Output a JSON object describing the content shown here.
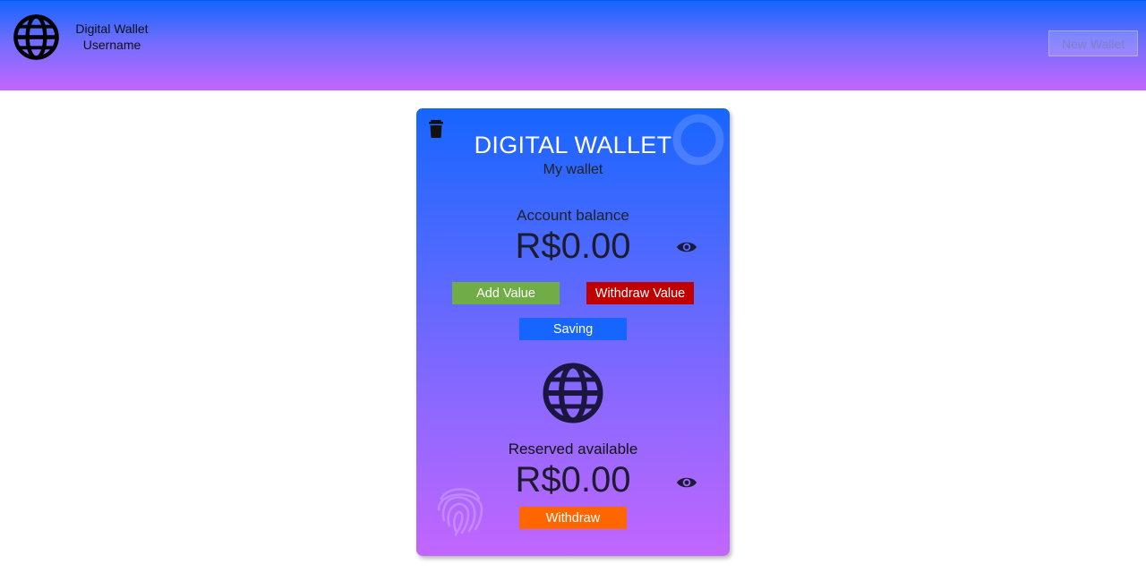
{
  "header": {
    "app_name": "Digital Wallet",
    "username": "Username",
    "new_wallet_label": "New Wallet",
    "logo_icon": "globe-icon"
  },
  "card": {
    "title": "DIGITAL WALLET",
    "subtitle": "My wallet",
    "balance_label": "Account balance",
    "balance_amount": "R$0.00",
    "add_value_label": "Add Value",
    "withdraw_value_label": "Withdraw Value",
    "saving_label": "Saving",
    "reserved_label": "Reserved available",
    "reserved_amount": "R$0.00",
    "withdraw_label": "Withdraw",
    "icons": [
      "trash-icon",
      "eye-icon",
      "globe-icon",
      "fingerprint-icon",
      "ring-icon"
    ]
  },
  "colors": {
    "gradient_top": "#1665ff",
    "gradient_bottom": "#c266fe",
    "add_value": "#70ad47",
    "withdraw_value": "#c00000",
    "saving": "#1665ff",
    "withdraw": "#ff6600"
  }
}
